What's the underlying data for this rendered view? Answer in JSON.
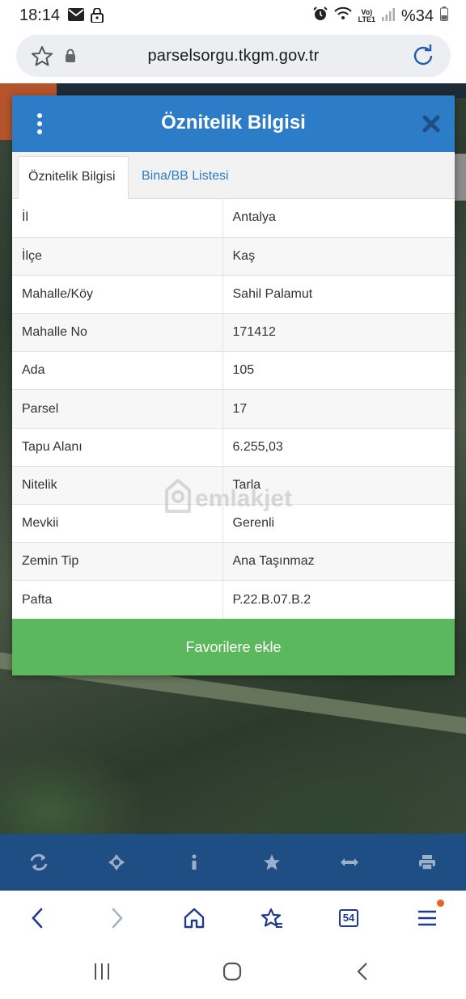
{
  "status_bar": {
    "time": "18:14",
    "battery": "%34",
    "network_label_top": "Vo)",
    "network_label_bottom": "LTE1"
  },
  "address_bar": {
    "url": "parselsorgu.tkgm.gov.tr"
  },
  "modal": {
    "title": "Öznitelik Bilgisi",
    "tabs": [
      {
        "label": "Öznitelik Bilgisi",
        "active": true
      },
      {
        "label": "Bina/BB Listesi",
        "active": false
      }
    ],
    "rows": [
      {
        "key": "İl",
        "value": "Antalya"
      },
      {
        "key": "İlçe",
        "value": "Kaş"
      },
      {
        "key": "Mahalle/Köy",
        "value": "Sahil Palamut"
      },
      {
        "key": "Mahalle No",
        "value": "171412"
      },
      {
        "key": "Ada",
        "value": "105"
      },
      {
        "key": "Parsel",
        "value": "17"
      },
      {
        "key": "Tapu Alanı",
        "value": "6.255,03"
      },
      {
        "key": "Nitelik",
        "value": "Tarla"
      },
      {
        "key": "Mevkii",
        "value": "Gerenli"
      },
      {
        "key": "Zemin Tip",
        "value": "Ana Taşınmaz"
      },
      {
        "key": "Pafta",
        "value": "P.22.B.07.B.2"
      }
    ],
    "favorite_button": "Favorilere ekle"
  },
  "watermark": {
    "text": "emlakjet"
  },
  "map_toolbar": {
    "tools": [
      "refresh-icon",
      "move-icon",
      "info-icon",
      "star-icon",
      "measure-icon",
      "print-icon"
    ]
  },
  "browser_nav": {
    "tabs_count": "54"
  },
  "colors": {
    "header_blue": "#2d7cc7",
    "toolbar_blue": "#1f4e85",
    "button_green": "#5cb85c",
    "notification_dot": "#e8631f"
  }
}
